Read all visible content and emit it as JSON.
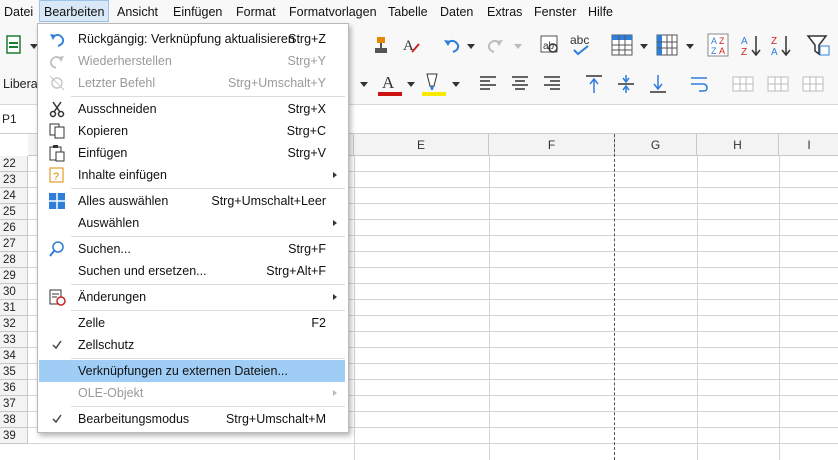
{
  "menubar": {
    "items": [
      "Datei",
      "Bearbeiten",
      "Ansicht",
      "Einfügen",
      "Format",
      "Formatvorlagen",
      "Tabelle",
      "Daten",
      "Extras",
      "Fenster",
      "Hilfe"
    ]
  },
  "toolbar": {
    "font_name_partial": "Liberat"
  },
  "namebox": {
    "value": "P1"
  },
  "columns": [
    "E",
    "F",
    "G",
    "H",
    "I"
  ],
  "rows": [
    "22",
    "23",
    "24",
    "25",
    "26",
    "27",
    "28",
    "29",
    "30",
    "31",
    "32",
    "33",
    "34",
    "35",
    "36",
    "37",
    "38",
    "39"
  ],
  "edit_menu": {
    "items": [
      {
        "label": "Rückgängig: Verknüpfung aktualisieren",
        "shortcut": "Strg+Z",
        "icon": "undo-icon",
        "state": "enabled"
      },
      {
        "label": "Wiederherstellen",
        "shortcut": "Strg+Y",
        "icon": "redo-icon",
        "state": "disabled"
      },
      {
        "label": "Letzter Befehl",
        "shortcut": "Strg+Umschalt+Y",
        "icon": "repeat-icon",
        "state": "disabled"
      },
      {
        "label": "Ausschneiden",
        "shortcut": "Strg+X",
        "icon": "scissors-icon",
        "state": "enabled"
      },
      {
        "label": "Kopieren",
        "shortcut": "Strg+C",
        "icon": "copy-icon",
        "state": "enabled"
      },
      {
        "label": "Einfügen",
        "shortcut": "Strg+V",
        "icon": "paste-icon",
        "state": "enabled"
      },
      {
        "label": "Inhalte einfügen",
        "shortcut": "",
        "icon": "paste-special-icon",
        "state": "submenu"
      },
      {
        "label": "Alles auswählen",
        "shortcut": "Strg+Umschalt+Leer",
        "icon": "select-all-icon",
        "state": "enabled"
      },
      {
        "label": "Auswählen",
        "shortcut": "",
        "icon": "",
        "state": "submenu"
      },
      {
        "label": "Suchen...",
        "shortcut": "Strg+F",
        "icon": "search-icon",
        "state": "enabled"
      },
      {
        "label": "Suchen und ersetzen...",
        "shortcut": "Strg+Alt+F",
        "icon": "",
        "state": "enabled"
      },
      {
        "label": "Änderungen",
        "shortcut": "",
        "icon": "track-changes-icon",
        "state": "submenu"
      },
      {
        "label": "Zelle",
        "shortcut": "F2",
        "icon": "",
        "state": "enabled"
      },
      {
        "label": "Zellschutz",
        "shortcut": "",
        "icon": "check-icon",
        "state": "checked"
      },
      {
        "label": "Verknüpfungen zu externen Dateien...",
        "shortcut": "",
        "icon": "",
        "state": "highlighted"
      },
      {
        "label": "OLE-Objekt",
        "shortcut": "",
        "icon": "",
        "state": "disabled-submenu"
      },
      {
        "label": "Bearbeitungsmodus",
        "shortcut": "Strg+Umschalt+M",
        "icon": "check-icon",
        "state": "checked"
      }
    ]
  },
  "colors": {
    "accent_blue": "#2f7fd8",
    "highlight": "#9fcdf5",
    "font_color_red": "#cc1111",
    "highlight_yellow": "#f5ea00"
  }
}
